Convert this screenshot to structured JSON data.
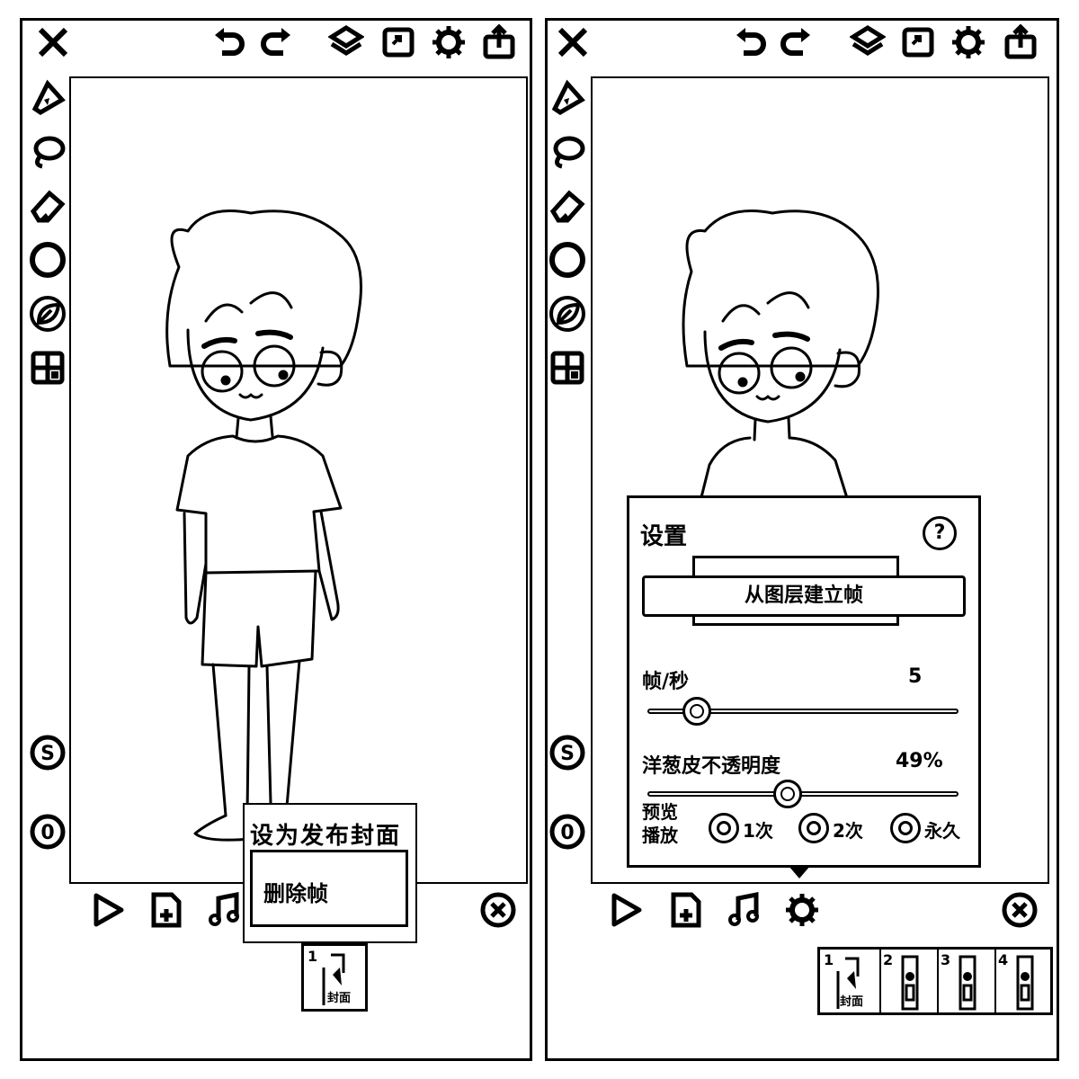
{
  "left_screen": {
    "toolbar_icons": [
      "close-icon",
      "undo-icon",
      "redo-icon",
      "layers-icon",
      "import-icon",
      "gear-icon",
      "share-icon"
    ],
    "side_tools": [
      "pen-icon",
      "lasso-icon",
      "eraser-icon",
      "circle-brush-icon",
      "leaf-icon",
      "grid-icon"
    ],
    "side_badges": [
      "S",
      "0"
    ],
    "context_menu": {
      "item1": "设为发布封面",
      "item2": "删除帧"
    },
    "frames": [
      {
        "number": "1",
        "cover_label": "封面"
      }
    ]
  },
  "right_screen": {
    "settings": {
      "title": "设置",
      "help_label": "?",
      "create_from_layers": "从图层建立帧",
      "fps_label": "帧/秒",
      "fps_value": "5",
      "fps_fraction": 0.16,
      "onion_label": "洋葱皮不透明度",
      "onion_value": "49%",
      "onion_fraction": 0.45,
      "preview_label": "预览播放",
      "preview_options": [
        "1次",
        "2次",
        "永久"
      ]
    },
    "frames": [
      {
        "number": "1",
        "cover_label": "封面"
      },
      {
        "number": "2",
        "cover_label": ""
      },
      {
        "number": "3",
        "cover_label": ""
      },
      {
        "number": "4",
        "cover_label": ""
      }
    ]
  }
}
